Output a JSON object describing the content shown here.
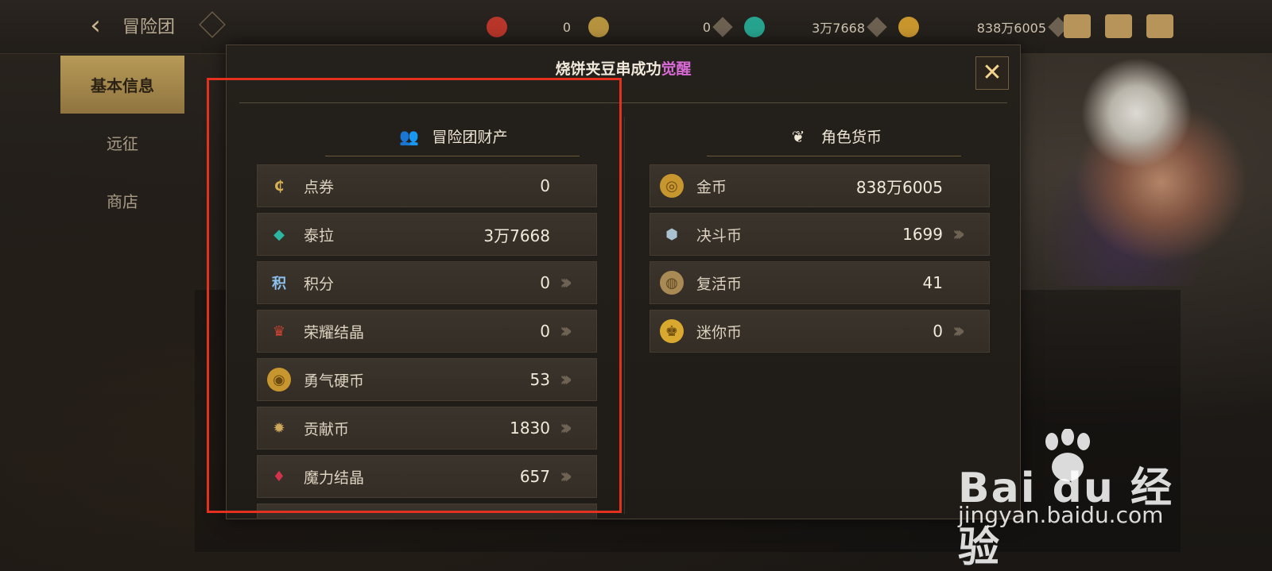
{
  "topbar": {
    "back_label": "‹",
    "page_name": "冒险团",
    "resources": [
      {
        "name": "honor-crystal",
        "value": "0",
        "color": "#c0392b"
      },
      {
        "name": "point-coupon",
        "value": "0",
        "color": "#c9a44a"
      },
      {
        "name": "tera",
        "value": "3万7668",
        "color": "#2bb7a1"
      },
      {
        "name": "gold",
        "value": "838万6005",
        "color": "#d6a536"
      }
    ]
  },
  "sidenav": {
    "items": [
      {
        "label": "基本信息",
        "active": true
      },
      {
        "label": "远征",
        "active": false
      },
      {
        "label": "商店",
        "active": false
      }
    ]
  },
  "modal": {
    "title_prefix": "烧饼夹豆串成功",
    "title_highlight": "觉醒",
    "left_section": {
      "title": "冒险团财产",
      "items": [
        {
          "label": "点券",
          "value": "0",
          "icon": "coupon-icon",
          "color": "#c9a44a",
          "arrow": false
        },
        {
          "label": "泰拉",
          "value": "3万7668",
          "icon": "tera-crystal-icon",
          "color": "#2bb7a1",
          "arrow": false
        },
        {
          "label": "积分",
          "value": "0",
          "icon": "points-icon",
          "color": "#7fb4e6",
          "arrow": true
        },
        {
          "label": "荣耀结晶",
          "value": "0",
          "icon": "trophy-icon",
          "color": "#c0392b",
          "arrow": true
        },
        {
          "label": "勇气硬币",
          "value": "53",
          "icon": "courage-coin-icon",
          "color": "#d6a536",
          "arrow": true
        },
        {
          "label": "贡献币",
          "value": "1830",
          "icon": "contribution-coin-icon",
          "color": "#c8a15a",
          "arrow": true
        },
        {
          "label": "魔力结晶",
          "value": "657",
          "icon": "magic-crystal-icon",
          "color": "#d2334a",
          "arrow": true
        }
      ]
    },
    "right_section": {
      "title": "角色货币",
      "items": [
        {
          "label": "金币",
          "value": "838万6005",
          "icon": "gold-coin-icon",
          "color": "#d6a536",
          "arrow": false
        },
        {
          "label": "决斗币",
          "value": "1699",
          "icon": "duel-coin-icon",
          "color": "#9fb6c4",
          "arrow": true
        },
        {
          "label": "复活币",
          "value": "41",
          "icon": "revive-coin-icon",
          "color": "#c9a86a",
          "arrow": false
        },
        {
          "label": "迷你币",
          "value": "0",
          "icon": "mini-coin-icon",
          "color": "#e0b23a",
          "arrow": true
        }
      ]
    },
    "close_label": "✕"
  },
  "watermark": {
    "brand": "Bai du 经验",
    "url": "jingyan.baidu.com"
  }
}
